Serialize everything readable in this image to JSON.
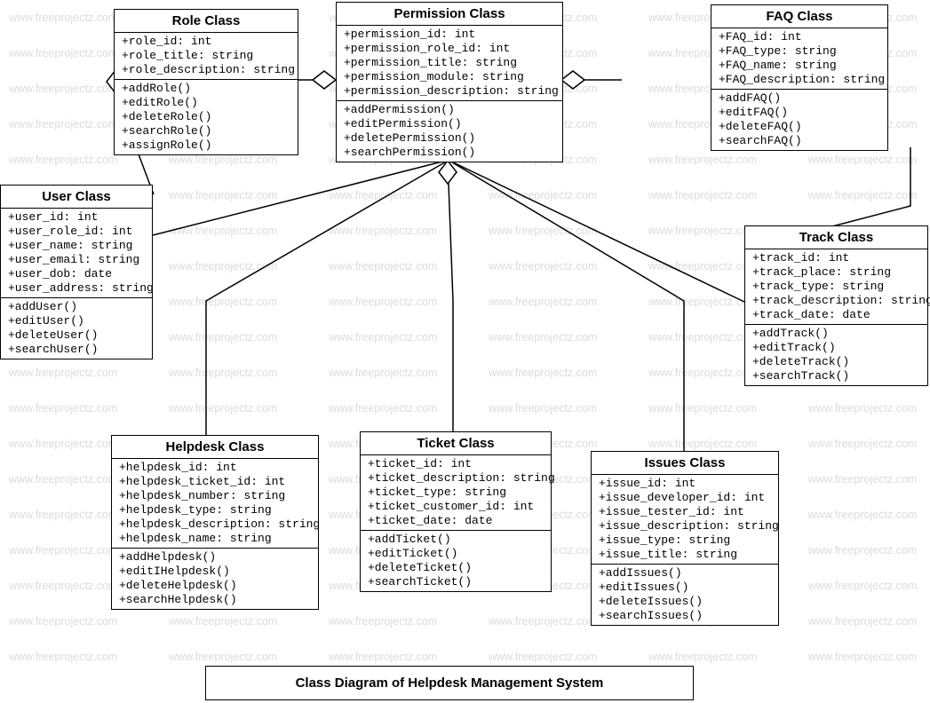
{
  "watermark_text": "www.freeprojectz.com",
  "caption": "Class Diagram of Helpdesk Management System",
  "classes": {
    "role": {
      "title": "Role Class",
      "attrs": [
        "+role_id: int",
        "+role_title: string",
        "+role_description: string"
      ],
      "ops": [
        "+addRole()",
        "+editRole()",
        "+deleteRole()",
        "+searchRole()",
        "+assignRole()"
      ]
    },
    "permission": {
      "title": "Permission Class",
      "attrs": [
        "+permission_id: int",
        "+permission_role_id: int",
        "+permission_title: string",
        "+permission_module: string",
        "+permission_description: string"
      ],
      "ops": [
        "+addPermission()",
        "+editPermission()",
        "+deletePermission()",
        "+searchPermission()"
      ]
    },
    "faq": {
      "title": "FAQ Class",
      "attrs": [
        "+FAQ_id: int",
        "+FAQ_type: string",
        "+FAQ_name: string",
        "+FAQ_description: string"
      ],
      "ops": [
        "+addFAQ()",
        "+editFAQ()",
        "+deleteFAQ()",
        "+searchFAQ()"
      ]
    },
    "user": {
      "title": "User Class",
      "attrs": [
        "+user_id: int",
        "+user_role_id: int",
        "+user_name: string",
        "+user_email: string",
        "+user_dob: date",
        "+user_address: string"
      ],
      "ops": [
        "+addUser()",
        "+editUser()",
        "+deleteUser()",
        "+searchUser()"
      ]
    },
    "track": {
      "title": "Track Class",
      "attrs": [
        "+track_id: int",
        "+track_place: string",
        "+track_type: string",
        "+track_description: string",
        "+track_date: date"
      ],
      "ops": [
        "+addTrack()",
        "+editTrack()",
        "+deleteTrack()",
        "+searchTrack()"
      ]
    },
    "helpdesk": {
      "title": "Helpdesk Class",
      "attrs": [
        "+helpdesk_id: int",
        "+helpdesk_ticket_id: int",
        "+helpdesk_number: string",
        "+helpdesk_type: string",
        "+helpdesk_description: string",
        "+helpdesk_name: string"
      ],
      "ops": [
        "+addHelpdesk()",
        "+editIHelpdesk()",
        "+deleteHelpdesk()",
        "+searchHelpdesk()"
      ]
    },
    "ticket": {
      "title": "Ticket Class",
      "attrs": [
        "+ticket_id: int",
        "+ticket_description: string",
        "+ticket_type: string",
        "+ticket_customer_id: int",
        "+ticket_date: date"
      ],
      "ops": [
        "+addTicket()",
        "+editTicket()",
        "+deleteTicket()",
        "+searchTicket()"
      ]
    },
    "issues": {
      "title": "Issues Class",
      "attrs": [
        "+issue_id: int",
        "+issue_developer_id: int",
        "+issue_tester_id: int",
        "+issue_description: string",
        "+issue_type: string",
        "+issue_title: string"
      ],
      "ops": [
        "+addIssues()",
        "+editIssues()",
        "+deleteIssues()",
        "+searchIssues()"
      ]
    }
  }
}
